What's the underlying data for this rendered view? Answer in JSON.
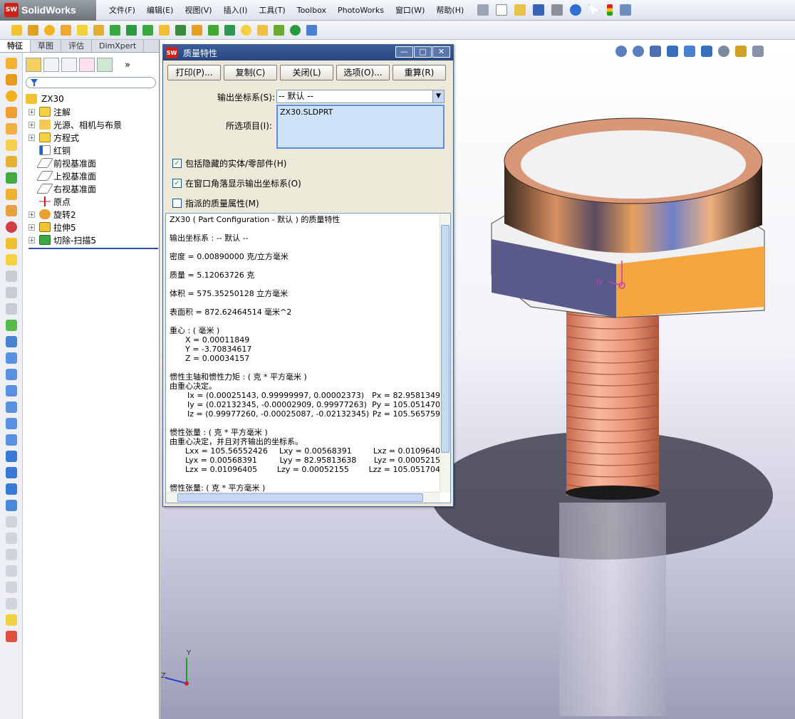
{
  "app": {
    "name": "SolidWorks",
    "logo_badge": "SW",
    "menu": [
      "文件(F)",
      "编辑(E)",
      "视图(V)",
      "插入(I)",
      "工具(T)",
      "Toolbox",
      "PhotoWorks",
      "窗口(W)",
      "帮助(H)"
    ]
  },
  "left": {
    "tabs": [
      "特征",
      "草图",
      "评估",
      "DimXpert"
    ],
    "filter_placeholder": "",
    "tree": {
      "root": "ZX30",
      "items": [
        {
          "label": "注解",
          "expandable": true
        },
        {
          "label": "光源、相机与布景",
          "expandable": true
        },
        {
          "label": "方程式",
          "expandable": true
        },
        {
          "label": "红铜",
          "expandable": false
        },
        {
          "label": "前视基准面",
          "expandable": false
        },
        {
          "label": "上视基准面",
          "expandable": false
        },
        {
          "label": "右视基准面",
          "expandable": false
        },
        {
          "label": "原点",
          "expandable": false
        },
        {
          "label": "旋转2",
          "expandable": true
        },
        {
          "label": "拉伸5",
          "expandable": true
        },
        {
          "label": "切除-扫描5",
          "expandable": true
        }
      ]
    }
  },
  "dialog": {
    "title": "质量特性",
    "buttons": [
      "打印(P)...",
      "复制(C)",
      "关闭(L)",
      "选项(O)...",
      "重算(R)"
    ],
    "coord_label": "输出坐标系(S):",
    "coord_value": "-- 默认 --",
    "selected_label": "所选项目(I):",
    "selected_value": "ZX30.SLDPRT",
    "check1": "包括隐藏的实体/零部件(H)",
    "check2": "在窗口角落显示输出坐标系(O)",
    "check3": "指派的质量属性(M)",
    "check1_on": true,
    "check2_on": true,
    "check3_on": false,
    "results": {
      "header": "ZX30 ( Part Configuration - 默认 ) 的质量特性",
      "coord": "输出坐标系 : -- 默认 --",
      "density": "密度 = 0.00890000 克/立方毫米",
      "mass": "质量 = 5.12063726 克",
      "volume": "体积 = 575.35250128 立方毫米",
      "area": "表面积 = 872.62464514 毫米^2",
      "cog_title": "重心 : ( 毫米 )",
      "cog_x": "X = 0.00011849",
      "cog_y": "Y = -3.70834617",
      "cog_z": "Z = 0.00034157",
      "principal_title": "惯性主轴和惯性力矩 : ( 克 * 平方毫米 )",
      "principal_sub": "由重心决定。",
      "ix": "Ix = (0.00025143, 0.99999997, 0.00002373)",
      "px": "Px = 82.9581349",
      "iy": "Iy = (0.02132345, -0.00002909, 0.99977263)",
      "py": "Py = 105.051470",
      "iz": "Iz = (0.99977260, -0.00025087, -0.02132345)",
      "pz": "Pz = 105.565759",
      "tensor_title": "惯性张量 : ( 克 * 平方毫米 )",
      "tensor_sub": "由重心决定，并且对齐输出的坐标系。",
      "lxx": "Lxx = 105.56552426",
      "lxy": "Lxy = 0.00568391",
      "lxz": "Lxz = 0.0109640",
      "lyx": "Lyx = 0.00568391",
      "lyy": "Lyy = 82.95813638",
      "lyz": "Lyz = 0.0005215",
      "lzx": "Lzx = 0.01096405",
      "lzy": "Lzy = 0.00052155",
      "lzz": "Lzz = 105.051704",
      "tensor2_title": "惯性张量: ( 克 * 平方毫米 )"
    }
  },
  "viewport": {
    "triad_y": "Y",
    "triad_z": "Z",
    "part_triad": "Iy",
    "copper_color": "#e8a07a",
    "nut_color": "#f5a540"
  }
}
